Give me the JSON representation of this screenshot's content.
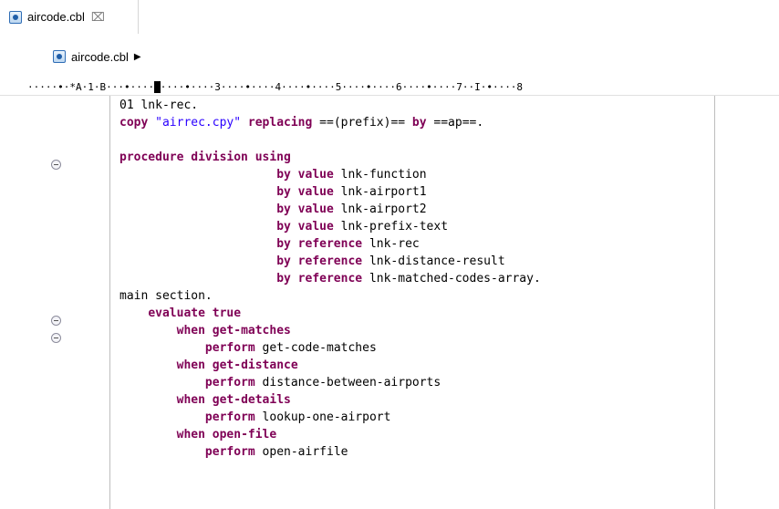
{
  "tab": {
    "title": "aircode.cbl",
    "close_glyph": "⌧"
  },
  "breadcrumb": {
    "file": "aircode.cbl",
    "arrow": "▶"
  },
  "ruler": {
    "before_marker": "·····•·*A·1·B···•····",
    "marker": "2",
    "after_marker": "····•····3····•····4····•····5····•····6····•····7··I·•····8"
  },
  "colors": {
    "keyword": "#7f0055",
    "string": "#2a00ff",
    "text": "#000000"
  },
  "code_lines": [
    {
      "parts": [
        {
          "t": "txt",
          "v": "01 lnk-rec."
        }
      ]
    },
    {
      "parts": [
        {
          "t": "kw",
          "v": "copy "
        },
        {
          "t": "str",
          "v": "\"airrec.cpy\" "
        },
        {
          "t": "kw",
          "v": "replacing "
        },
        {
          "t": "txt",
          "v": "==(prefix)== "
        },
        {
          "t": "kw",
          "v": "by "
        },
        {
          "t": "txt",
          "v": "==ap==."
        }
      ]
    },
    {
      "parts": [
        {
          "t": "txt",
          "v": ""
        }
      ]
    },
    {
      "parts": [
        {
          "t": "kw",
          "v": "procedure division using"
        }
      ]
    },
    {
      "parts": [
        {
          "t": "txt",
          "v": "                      "
        },
        {
          "t": "kw",
          "v": "by value "
        },
        {
          "t": "txt",
          "v": "lnk-function"
        }
      ]
    },
    {
      "parts": [
        {
          "t": "txt",
          "v": "                      "
        },
        {
          "t": "kw",
          "v": "by value "
        },
        {
          "t": "txt",
          "v": "lnk-airport1"
        }
      ]
    },
    {
      "parts": [
        {
          "t": "txt",
          "v": "                      "
        },
        {
          "t": "kw",
          "v": "by value "
        },
        {
          "t": "txt",
          "v": "lnk-airport2"
        }
      ]
    },
    {
      "parts": [
        {
          "t": "txt",
          "v": "                      "
        },
        {
          "t": "kw",
          "v": "by value "
        },
        {
          "t": "txt",
          "v": "lnk-prefix-text"
        }
      ]
    },
    {
      "parts": [
        {
          "t": "txt",
          "v": "                      "
        },
        {
          "t": "kw",
          "v": "by reference "
        },
        {
          "t": "txt",
          "v": "lnk-rec"
        }
      ]
    },
    {
      "parts": [
        {
          "t": "txt",
          "v": "                      "
        },
        {
          "t": "kw",
          "v": "by reference "
        },
        {
          "t": "txt",
          "v": "lnk-distance-result"
        }
      ]
    },
    {
      "parts": [
        {
          "t": "txt",
          "v": "                      "
        },
        {
          "t": "kw",
          "v": "by reference "
        },
        {
          "t": "txt",
          "v": "lnk-matched-codes-array."
        }
      ]
    },
    {
      "parts": [
        {
          "t": "txt",
          "v": "main section."
        }
      ]
    },
    {
      "parts": [
        {
          "t": "txt",
          "v": "    "
        },
        {
          "t": "kw",
          "v": "evaluate true"
        }
      ]
    },
    {
      "parts": [
        {
          "t": "txt",
          "v": "        "
        },
        {
          "t": "kw",
          "v": "when "
        },
        {
          "t": "kw",
          "v": "get-matches"
        }
      ]
    },
    {
      "parts": [
        {
          "t": "txt",
          "v": "            "
        },
        {
          "t": "kw",
          "v": "perform "
        },
        {
          "t": "txt",
          "v": "get-code-matches"
        }
      ]
    },
    {
      "parts": [
        {
          "t": "txt",
          "v": "        "
        },
        {
          "t": "kw",
          "v": "when "
        },
        {
          "t": "kw",
          "v": "get-distance"
        }
      ]
    },
    {
      "parts": [
        {
          "t": "txt",
          "v": "            "
        },
        {
          "t": "kw",
          "v": "perform "
        },
        {
          "t": "txt",
          "v": "distance-between-airports"
        }
      ]
    },
    {
      "parts": [
        {
          "t": "txt",
          "v": "        "
        },
        {
          "t": "kw",
          "v": "when "
        },
        {
          "t": "kw",
          "v": "get-details"
        }
      ]
    },
    {
      "parts": [
        {
          "t": "txt",
          "v": "            "
        },
        {
          "t": "kw",
          "v": "perform "
        },
        {
          "t": "txt",
          "v": "lookup-one-airport"
        }
      ]
    },
    {
      "parts": [
        {
          "t": "txt",
          "v": "        "
        },
        {
          "t": "kw",
          "v": "when "
        },
        {
          "t": "kw",
          "v": "open-file"
        }
      ]
    },
    {
      "parts": [
        {
          "t": "txt",
          "v": "            "
        },
        {
          "t": "kw",
          "v": "perform "
        },
        {
          "t": "txt",
          "v": "open-airfile"
        }
      ]
    }
  ]
}
